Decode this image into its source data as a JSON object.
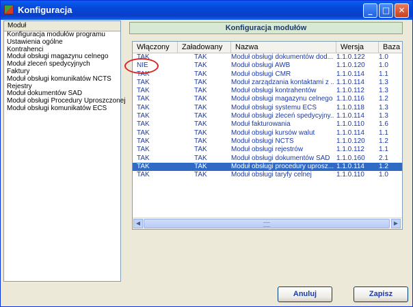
{
  "window": {
    "title": "Konfiguracja",
    "minimize": "_",
    "maximize": "□",
    "close": "✕"
  },
  "sidebar": {
    "header": "Moduł",
    "items": [
      "Konfiguracja modułów programu",
      "Ustawienia ogólne",
      "Kontrahenci",
      "Moduł obsługi magazynu celnego",
      "Moduł zleceń spedycyjnych",
      "Faktury",
      "Moduł obsługi komunikatów NCTS",
      "Rejestry",
      "Moduł dokumentów SAD",
      "Moduł obsługi Procedury Uproszczonej",
      "Moduł obsługi komunikatów ECS"
    ]
  },
  "main": {
    "header": "Konfiguracja modułów",
    "columns": [
      "Włączony",
      "Załadowany",
      "Nazwa",
      "Wersja",
      "Baza"
    ],
    "rows": [
      [
        "TAK",
        "TAK",
        "Moduł obsługi dokumentów dod...",
        "1.1.0.122",
        "1.0"
      ],
      [
        "NIE",
        "TAK",
        "Moduł obsługi AWB",
        "1.1.0.120",
        "1.0"
      ],
      [
        "TAK",
        "TAK",
        "Moduł obsługi CMR",
        "1.1.0.114",
        "1.1"
      ],
      [
        "TAK",
        "TAK",
        "Moduł zarządzania kontaktami z ...",
        "1.1.0.114",
        "1.3"
      ],
      [
        "TAK",
        "TAK",
        "Moduł obsługi kontrahentów",
        "1.1.0.112",
        "1.3"
      ],
      [
        "TAK",
        "TAK",
        "Moduł obsługi magazynu celnego",
        "1.1.0.116",
        "1.2"
      ],
      [
        "TAK",
        "TAK",
        "Moduł obsługi systemu ECS",
        "1.1.0.118",
        "1.3"
      ],
      [
        "TAK",
        "TAK",
        "Moduł obsługi zleceń spedycyjny...",
        "1.1.0.114",
        "1.3"
      ],
      [
        "TAK",
        "TAK",
        "Moduł fakturowania",
        "1.1.0.110",
        "1.6"
      ],
      [
        "TAK",
        "TAK",
        "Moduł obsługi kursów walut",
        "1.1.0.114",
        "1.1"
      ],
      [
        "TAK",
        "TAK",
        "Moduł obsługi NCTS",
        "1.1.0.120",
        "1.2"
      ],
      [
        "TAK",
        "TAK",
        "Moduł obsługi rejestrów",
        "1.1.0.112",
        "1.1"
      ],
      [
        "TAK",
        "TAK",
        "Moduł obsługi dokumentów SAD",
        "1.1.0.160",
        "2.1"
      ],
      [
        "TAK",
        "TAK",
        "Moduł obsługi procedury uprosz...",
        "1.1.0.114",
        "1.2"
      ],
      [
        "TAK",
        "TAK",
        "Moduł obsługi taryfy celnej",
        "1.1.0.110",
        "1.0"
      ]
    ],
    "selected_row_index": 13
  },
  "scrollbar": {
    "left_arrow": "◀",
    "right_arrow": "▶"
  },
  "buttons": {
    "cancel": "Anuluj",
    "save": "Zapisz"
  },
  "colors": {
    "titlebar": "#0a5ff0",
    "selected_row": "#316ac5",
    "row_text": "#1a3aa8",
    "annotation": "#d62828"
  }
}
